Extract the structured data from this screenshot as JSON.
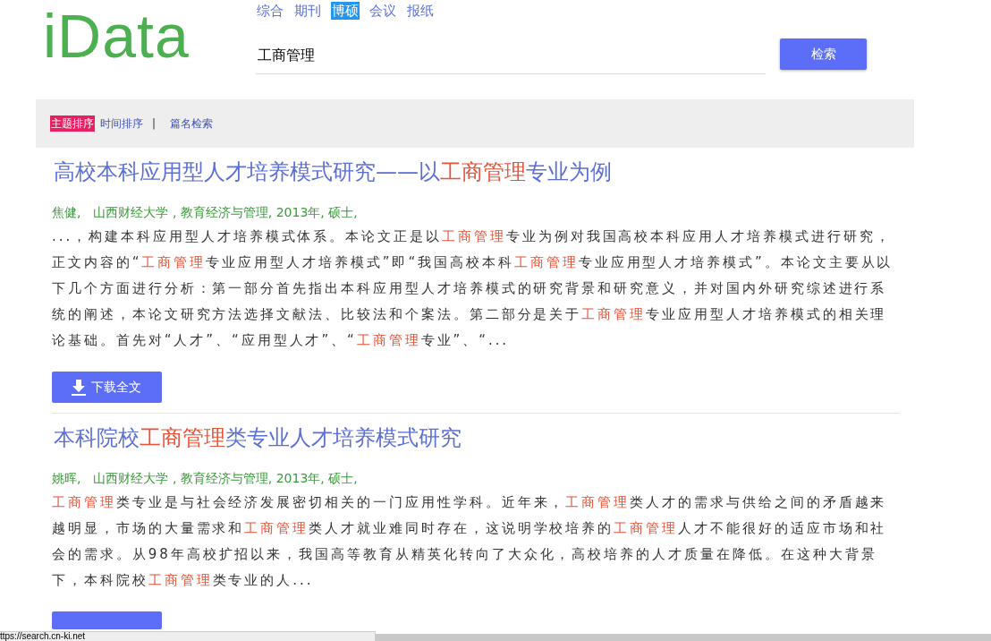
{
  "logo": "iData",
  "tabs": [
    {
      "label": "综合",
      "selected": false
    },
    {
      "label": "期刊",
      "selected": false
    },
    {
      "label": "博硕",
      "selected": true
    },
    {
      "label": "会议",
      "selected": false
    },
    {
      "label": "报纸",
      "selected": false
    }
  ],
  "search": {
    "value": "工商管理",
    "button": "检索"
  },
  "sort": [
    {
      "label": "主题排序",
      "selected": true
    },
    {
      "label": "时间排序",
      "selected": false
    }
  ],
  "separator": "|",
  "title_search": "篇名检索",
  "results": [
    {
      "title": [
        {
          "text": "高校本科应用型人才培养模式研究——以",
          "highlight": false
        },
        {
          "text": "工商管理",
          "highlight": true
        },
        {
          "text": "专业为例",
          "highlight": false
        }
      ],
      "author": "焦健,",
      "meta": "山西财经大学 , 教育经济与管理,  2013年,  硕士,",
      "abstract": [
        {
          "text": "...，构建本科应用型人才培养模式体系。本论文正是以",
          "highlight": false
        },
        {
          "text": "工商管理",
          "highlight": true
        },
        {
          "text": "专业为例对我国高校本科应用人才培养模式进行研究，正文内容的“",
          "highlight": false
        },
        {
          "text": "工商管理",
          "highlight": true
        },
        {
          "text": "专业应用型人才培养模式”即“我国高校本科",
          "highlight": false
        },
        {
          "text": "工商管理",
          "highlight": true
        },
        {
          "text": "专业应用型人才培养模式”。本论文主要从以下几个方面进行分析：第一部分首先指出本科应用型人才培养模式的研究背景和研究意义，并对国内外研究综述进行系统的阐述，本论文研究方法选择文献法、比较法和个案法。第二部分是关于",
          "highlight": false
        },
        {
          "text": "工商管理",
          "highlight": true
        },
        {
          "text": "专业应用型人才培养模式的相关理论基础。首先对“人才”、“应用型人才”、“",
          "highlight": false
        },
        {
          "text": "工商管理",
          "highlight": true
        },
        {
          "text": "专业”、“...",
          "highlight": false
        }
      ],
      "download": "下载全文"
    },
    {
      "title": [
        {
          "text": "本科院校",
          "highlight": false
        },
        {
          "text": "工商管理",
          "highlight": true
        },
        {
          "text": "类专业人才培养模式研究",
          "highlight": false
        }
      ],
      "author": "姚晖,",
      "meta": "山西财经大学 , 教育经济与管理,  2013年,  硕士,",
      "abstract": [
        {
          "text": "工商管理",
          "highlight": true
        },
        {
          "text": "类专业是与社会经济发展密切相关的一门应用性学科。近年来，",
          "highlight": false
        },
        {
          "text": "工商管理",
          "highlight": true
        },
        {
          "text": "类人才的需求与供给之间的矛盾越来越明显，市场的大量需求和",
          "highlight": false
        },
        {
          "text": "工商管理",
          "highlight": true
        },
        {
          "text": "类人才就业难同时存在，这说明学校培养的",
          "highlight": false
        },
        {
          "text": "工商管理",
          "highlight": true
        },
        {
          "text": "人才不能很好的适应市场和社会的需求。从98年高校扩招以来，我国高等教育从精英化转向了大众化，高校培养的人才质量在降低。在这种大背景下，本科院校",
          "highlight": false
        },
        {
          "text": "工商管理",
          "highlight": true
        },
        {
          "text": "类专业的人...",
          "highlight": false
        }
      ]
    }
  ],
  "status_url": "ttps://search.cn-ki.net"
}
